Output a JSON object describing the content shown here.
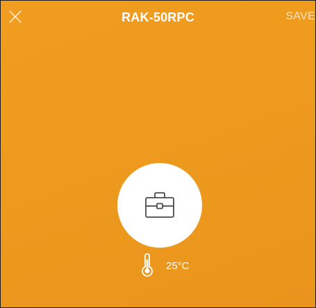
{
  "header": {
    "title": "RAK-50RPC",
    "save_label": "SAVE",
    "close_icon": "close-icon"
  },
  "mode": {
    "icon": "briefcase-icon"
  },
  "status": {
    "temperature": "25°C",
    "temperature_icon": "thermometer-icon"
  },
  "colors": {
    "background": "#ee9a1e",
    "circle": "#ffffff",
    "icon_stroke": "#4a4a4a",
    "text": "#ffffff"
  }
}
